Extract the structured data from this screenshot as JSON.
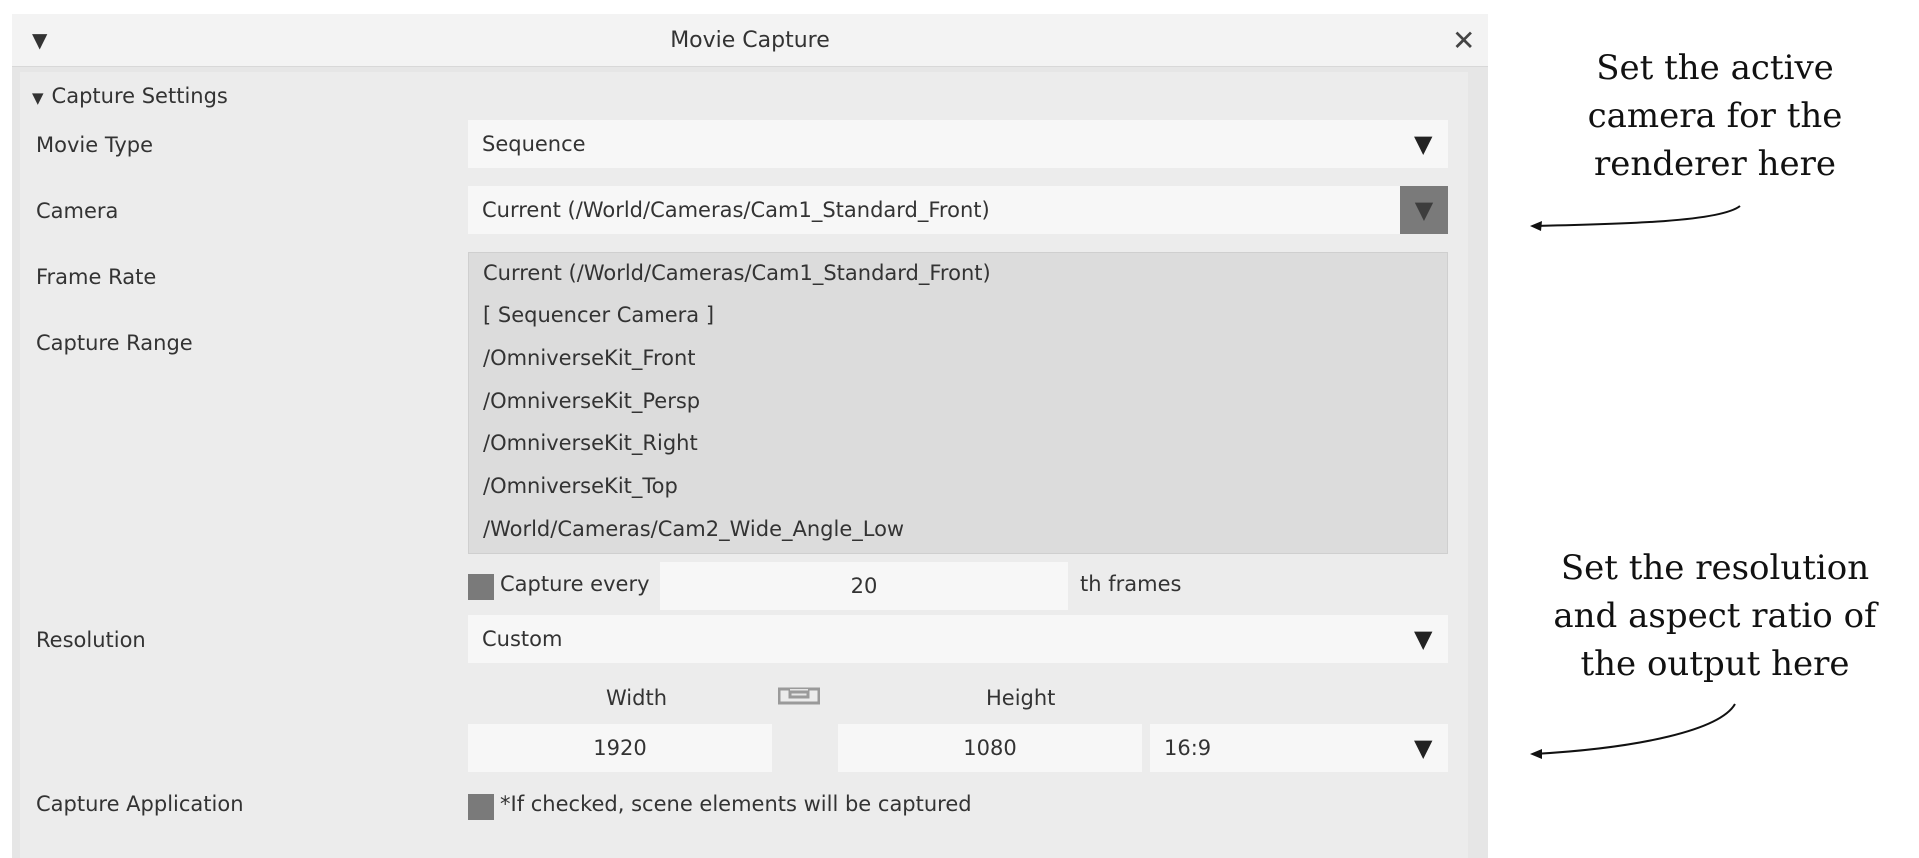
{
  "window": {
    "title": "Movie Capture"
  },
  "section": {
    "title": "Capture Settings"
  },
  "labels": {
    "movie_type": "Movie Type",
    "camera": "Camera",
    "frame_rate": "Frame Rate",
    "capture_range": "Capture Range",
    "resolution": "Resolution",
    "capture_application": "Capture Application"
  },
  "movie_type": {
    "value": "Sequence"
  },
  "camera": {
    "value": "Current (/World/Cameras/Cam1_Standard_Front)",
    "options": [
      "Current (/World/Cameras/Cam1_Standard_Front)",
      "[ Sequencer Camera ]",
      "/OmniverseKit_Front",
      "/OmniverseKit_Persp",
      "/OmniverseKit_Right",
      "/OmniverseKit_Top",
      "/World/Cameras/Cam2_Wide_Angle_Low"
    ]
  },
  "capture_every": {
    "prefix": "Capture every",
    "value": "20",
    "suffix": "th frames"
  },
  "resolution": {
    "value": "Custom",
    "width_label": "Width",
    "height_label": "Height",
    "width": "1920",
    "height": "1080",
    "aspect": "16:9"
  },
  "capture_application": {
    "note": "*If checked, scene elements will be captured"
  },
  "annotations": {
    "camera_note": "Set the active camera for the renderer here",
    "resolution_note": "Set the resolution and aspect ratio of the output here"
  },
  "icons": {
    "collapse": "triangle-down-icon",
    "close": "close-icon",
    "dropdown": "triangle-down-icon",
    "link": "link-icon"
  }
}
